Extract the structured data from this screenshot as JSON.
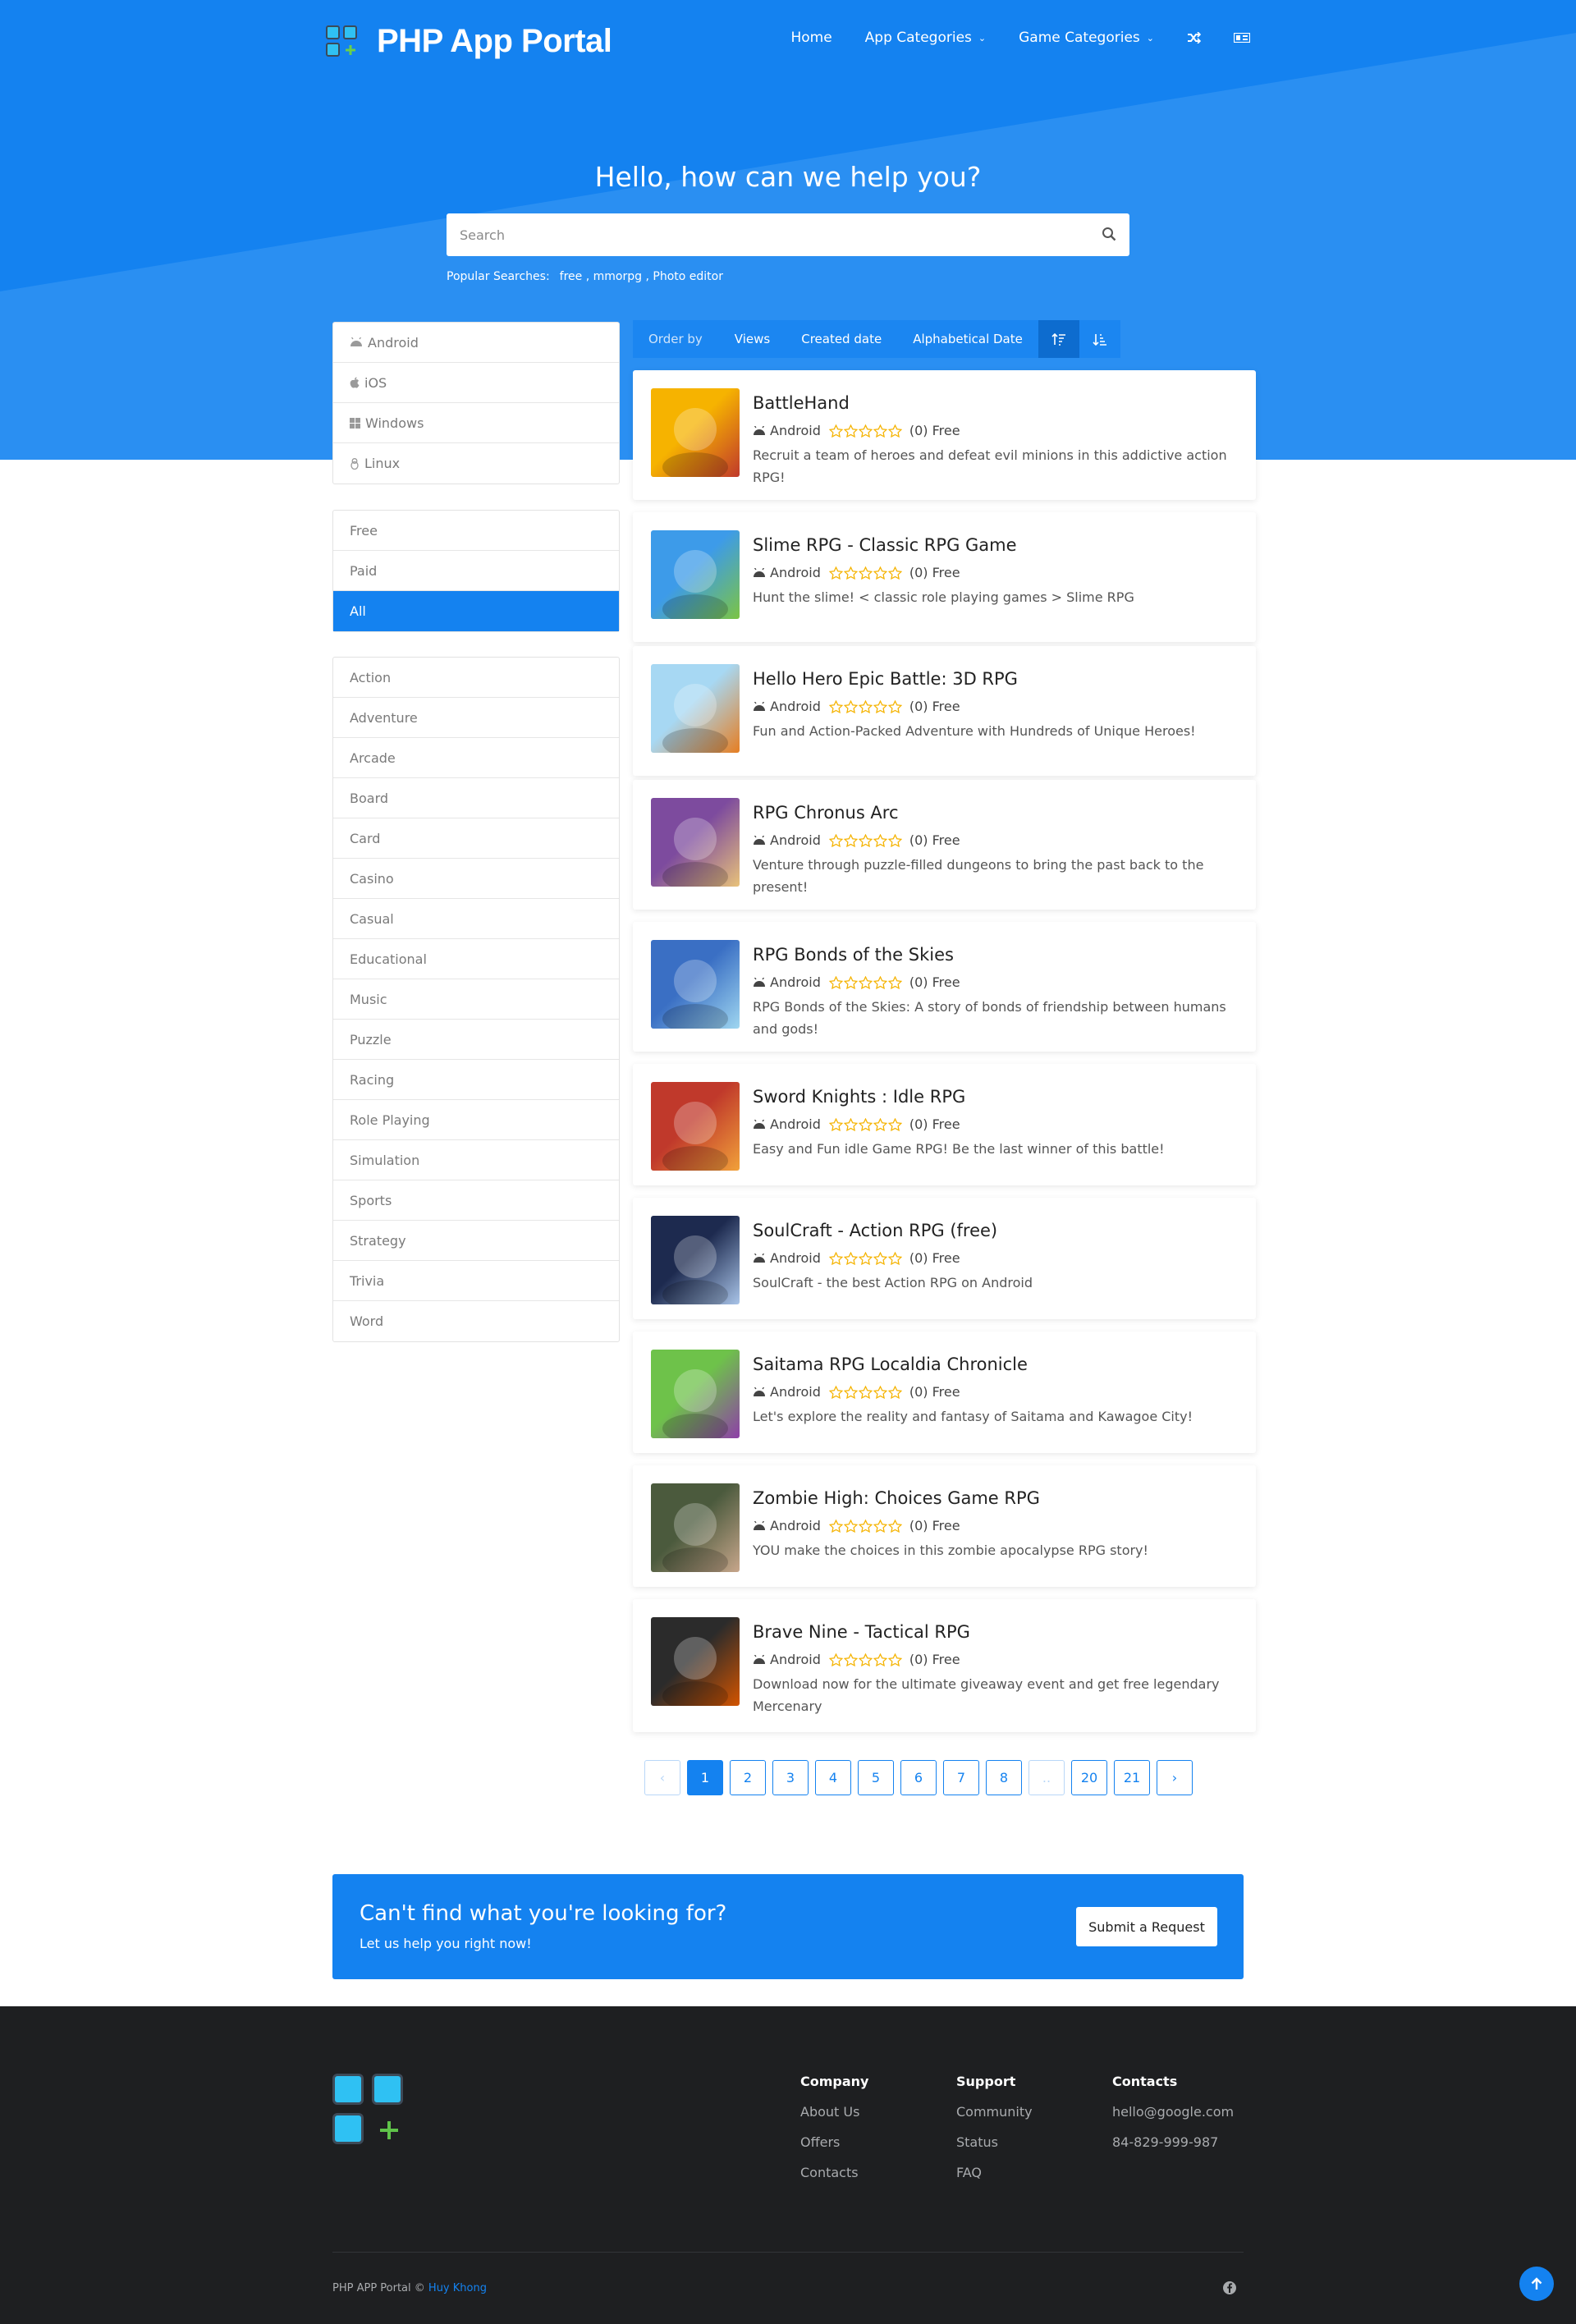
{
  "brand": {
    "title": "PHP App Portal"
  },
  "nav": {
    "home": "Home",
    "app_categories": "App Categories",
    "game_categories": "Game Categories",
    "shuffle_icon": "shuffle-icon",
    "language_icon": "flag-icon"
  },
  "hero": {
    "title": "Hello, how can we help you?",
    "search_placeholder": "Search",
    "popular_label": "Popular Searches:",
    "popular_links": [
      "free",
      "mmorpg",
      "Photo editor"
    ]
  },
  "platforms": [
    "Android",
    "iOS",
    "Windows",
    "Linux"
  ],
  "prices": [
    "Free",
    "Paid",
    "All"
  ],
  "price_selected": "All",
  "categories": [
    "Action",
    "Adventure",
    "Arcade",
    "Board",
    "Card",
    "Casino",
    "Casual",
    "Educational",
    "Music",
    "Puzzle",
    "Racing",
    "Role Playing",
    "Simulation",
    "Sports",
    "Strategy",
    "Trivia",
    "Word"
  ],
  "orderbar": {
    "label": "Order by",
    "options": [
      "Views",
      "Created date",
      "Alphabetical Date"
    ]
  },
  "apps": [
    {
      "title": "BattleHand",
      "platform": "Android",
      "count": "(0)",
      "price": "Free",
      "description": "Recruit a team of heroes and defeat evil minions in this addictive action RPG!"
    },
    {
      "title": "Slime RPG - Classic RPG Game",
      "platform": "Android",
      "count": "(0)",
      "price": "Free",
      "description": "Hunt the slime! < classic role playing games > Slime RPG"
    },
    {
      "title": "Hello Hero Epic Battle: 3D RPG",
      "platform": "Android",
      "count": "(0)",
      "price": "Free",
      "description": "Fun and Action-Packed Adventure with Hundreds of Unique Heroes!"
    },
    {
      "title": "RPG Chronus Arc",
      "platform": "Android",
      "count": "(0)",
      "price": "Free",
      "description": "Venture through puzzle-filled dungeons to bring the past back to the present!"
    },
    {
      "title": "RPG Bonds of the Skies",
      "platform": "Android",
      "count": "(0)",
      "price": "Free",
      "description": "RPG Bonds of the Skies: A story of bonds of friendship between humans and gods!"
    },
    {
      "title": "Sword Knights : Idle RPG",
      "platform": "Android",
      "count": "(0)",
      "price": "Free",
      "description": "Easy and Fun idle Game RPG! Be the last winner of this battle!"
    },
    {
      "title": "SoulCraft - Action RPG (free)",
      "platform": "Android",
      "count": "(0)",
      "price": "Free",
      "description": "SoulCraft - the best Action RPG on Android"
    },
    {
      "title": "Saitama RPG Localdia Chronicle",
      "platform": "Android",
      "count": "(0)",
      "price": "Free",
      "description": "Let's explore the reality and fantasy of Saitama and Kawagoe City!"
    },
    {
      "title": "Zombie High: Choices Game RPG",
      "platform": "Android",
      "count": "(0)",
      "price": "Free",
      "description": "YOU make the choices in this zombie apocalypse RPG story!"
    },
    {
      "title": "Brave Nine - Tactical RPG",
      "platform": "Android",
      "count": "(0)",
      "price": "Free",
      "description": "Download now for the ultimate giveaway event and get free legendary Mercenary"
    }
  ],
  "pagination": {
    "prev": "‹",
    "pages": [
      "1",
      "2",
      "3",
      "4",
      "5",
      "6",
      "7",
      "8",
      "..",
      "20",
      "21"
    ],
    "next": "›",
    "current": "1"
  },
  "cta": {
    "title": "Can't find what you're looking for?",
    "subtitle": "Let us help you right now!",
    "button": "Submit a Request"
  },
  "footer": {
    "columns": [
      {
        "heading": "Company",
        "links": [
          "About Us",
          "Offers",
          "Contacts"
        ]
      },
      {
        "heading": "Support",
        "links": [
          "Community",
          "Status",
          "FAQ"
        ]
      },
      {
        "heading": "Contacts",
        "links": [
          "hello@google.com",
          "84-829-999-987"
        ]
      }
    ],
    "copyright": "PHP APP Portal ©",
    "author": "Huy Khong"
  },
  "colors": {
    "primary": "#1482f0",
    "footer_bg": "#1e1f21",
    "star": "#f5b301"
  }
}
